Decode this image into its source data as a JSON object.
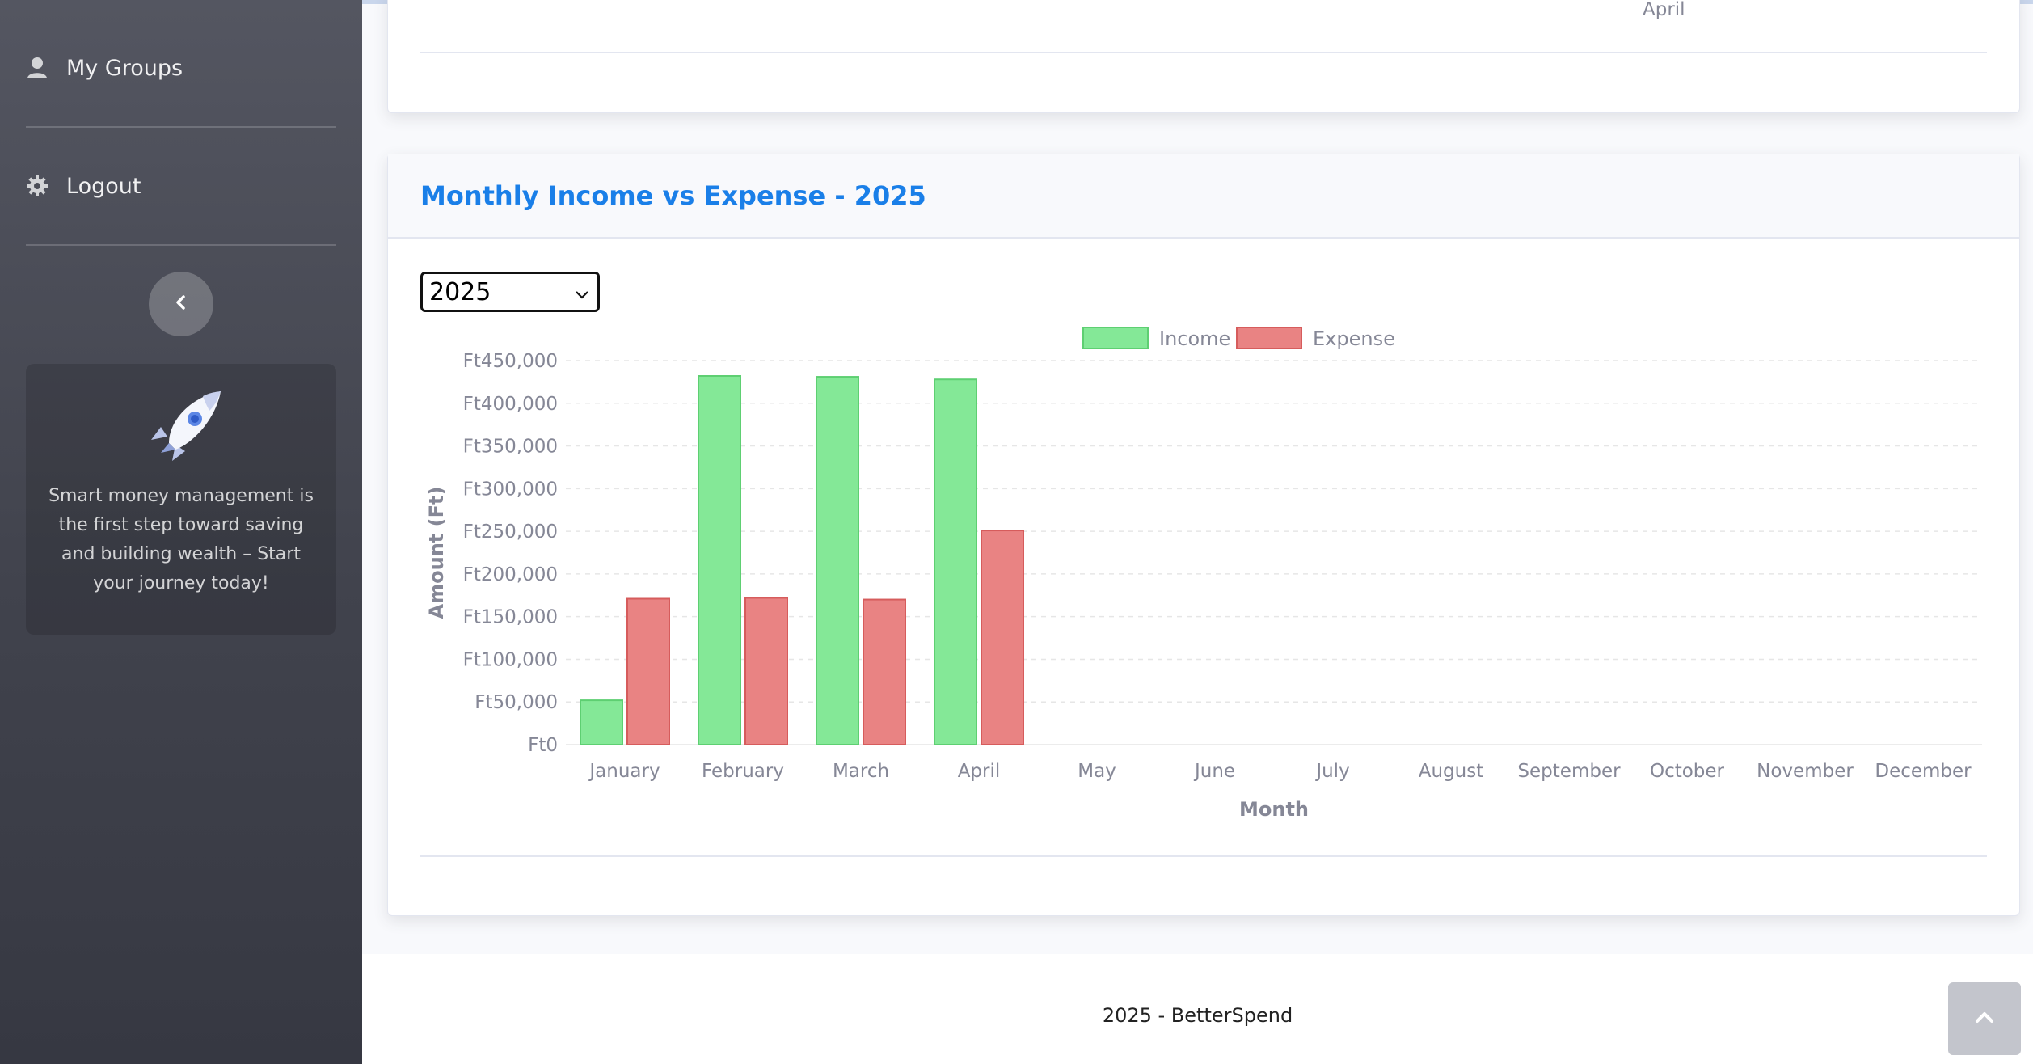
{
  "sidebar": {
    "items": [
      {
        "label": "My Groups",
        "icon": "user-icon"
      },
      {
        "label": "Logout",
        "icon": "gear-icon"
      }
    ],
    "promo_text": "Smart money management is the first step toward saving and building wealth – Start your journey today!"
  },
  "top_card": {
    "x_tick_label": "April"
  },
  "main_card": {
    "title": "Monthly Income vs Expense - 2025",
    "year_select": {
      "selected": "2025"
    }
  },
  "chart_data": {
    "type": "bar",
    "categories": [
      "January",
      "February",
      "March",
      "April",
      "May",
      "June",
      "July",
      "August",
      "September",
      "October",
      "November",
      "December"
    ],
    "series": [
      {
        "name": "Income",
        "values": [
          52000,
          432000,
          431000,
          428000,
          0,
          0,
          0,
          0,
          0,
          0,
          0,
          0
        ],
        "color": "#84e897",
        "border": "#5ecf72"
      },
      {
        "name": "Expense",
        "values": [
          171000,
          172000,
          170000,
          251000,
          0,
          0,
          0,
          0,
          0,
          0,
          0,
          0
        ],
        "color": "#e98383",
        "border": "#d65c5c"
      }
    ],
    "yticks": [
      "Ft0",
      "Ft50,000",
      "Ft100,000",
      "Ft150,000",
      "Ft200,000",
      "Ft250,000",
      "Ft300,000",
      "Ft350,000",
      "Ft400,000",
      "Ft450,000"
    ],
    "ylim": [
      0,
      450000
    ],
    "xlabel": "Month",
    "ylabel": "Amount (Ft)",
    "legend_position": "top",
    "grid": true
  },
  "footer": {
    "copyright": "2025 - BetterSpend"
  },
  "colors": {
    "accent": "#1a7fe8",
    "sidebar": "#454750"
  }
}
